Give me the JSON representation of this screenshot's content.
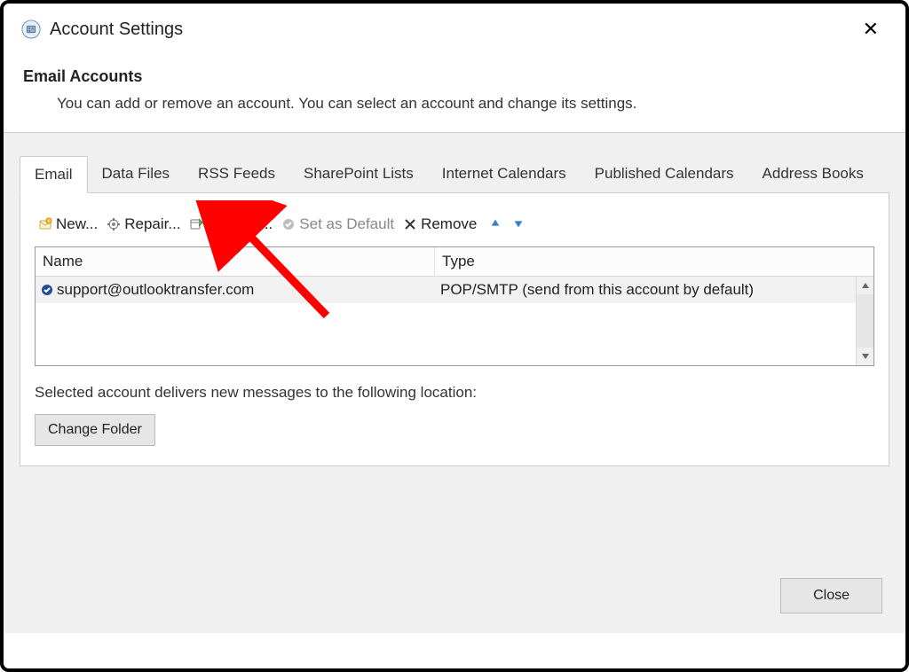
{
  "window": {
    "title": "Account Settings",
    "close_glyph": "✕"
  },
  "header": {
    "title": "Email Accounts",
    "subtitle": "You can add or remove an account. You can select an account and change its settings."
  },
  "tabs": [
    {
      "label": "Email",
      "active": true
    },
    {
      "label": "Data Files"
    },
    {
      "label": "RSS Feeds"
    },
    {
      "label": "SharePoint Lists"
    },
    {
      "label": "Internet Calendars"
    },
    {
      "label": "Published Calendars"
    },
    {
      "label": "Address Books"
    }
  ],
  "toolbar": {
    "new_label": "New...",
    "repair_label": "Repair...",
    "change_label": "Change...",
    "set_default_label": "Set as Default",
    "remove_label": "Remove"
  },
  "list": {
    "columns": {
      "name": "Name",
      "type": "Type"
    },
    "rows": [
      {
        "name": "support@outlooktransfer.com",
        "type": "POP/SMTP (send from this account by default)"
      }
    ]
  },
  "location_text": "Selected account delivers new messages to the following location:",
  "change_folder_label": "Change Folder",
  "close_label": "Close"
}
